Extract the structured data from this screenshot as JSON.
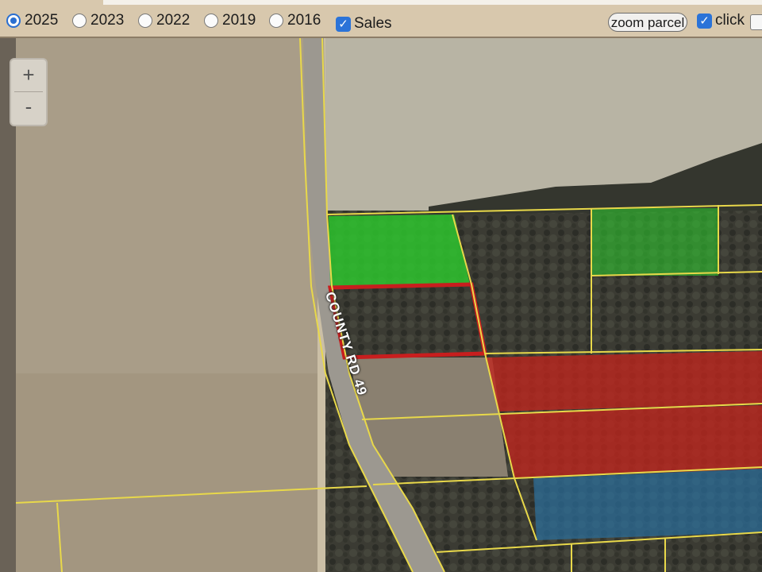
{
  "toolbar": {
    "years": [
      {
        "label": "2025",
        "selected": true
      },
      {
        "label": "2023",
        "selected": false
      },
      {
        "label": "2022",
        "selected": false
      },
      {
        "label": "2019",
        "selected": false
      },
      {
        "label": "2016",
        "selected": false
      }
    ],
    "sales_label": "Sales",
    "sales_checked": true,
    "zoom_button_label": "zoom parcel",
    "click_label": "click",
    "click_checked": true
  },
  "map": {
    "zoom_in_label": "+",
    "zoom_out_label": "-",
    "road_label": "COUNTY RD 49",
    "colors": {
      "parcel_line": "#e8d84a",
      "selected_outline": "#c81e1e",
      "sale_green": "#2ec42e",
      "sale_red": "#c0251e",
      "sale_blue": "#2a6f9e"
    }
  }
}
